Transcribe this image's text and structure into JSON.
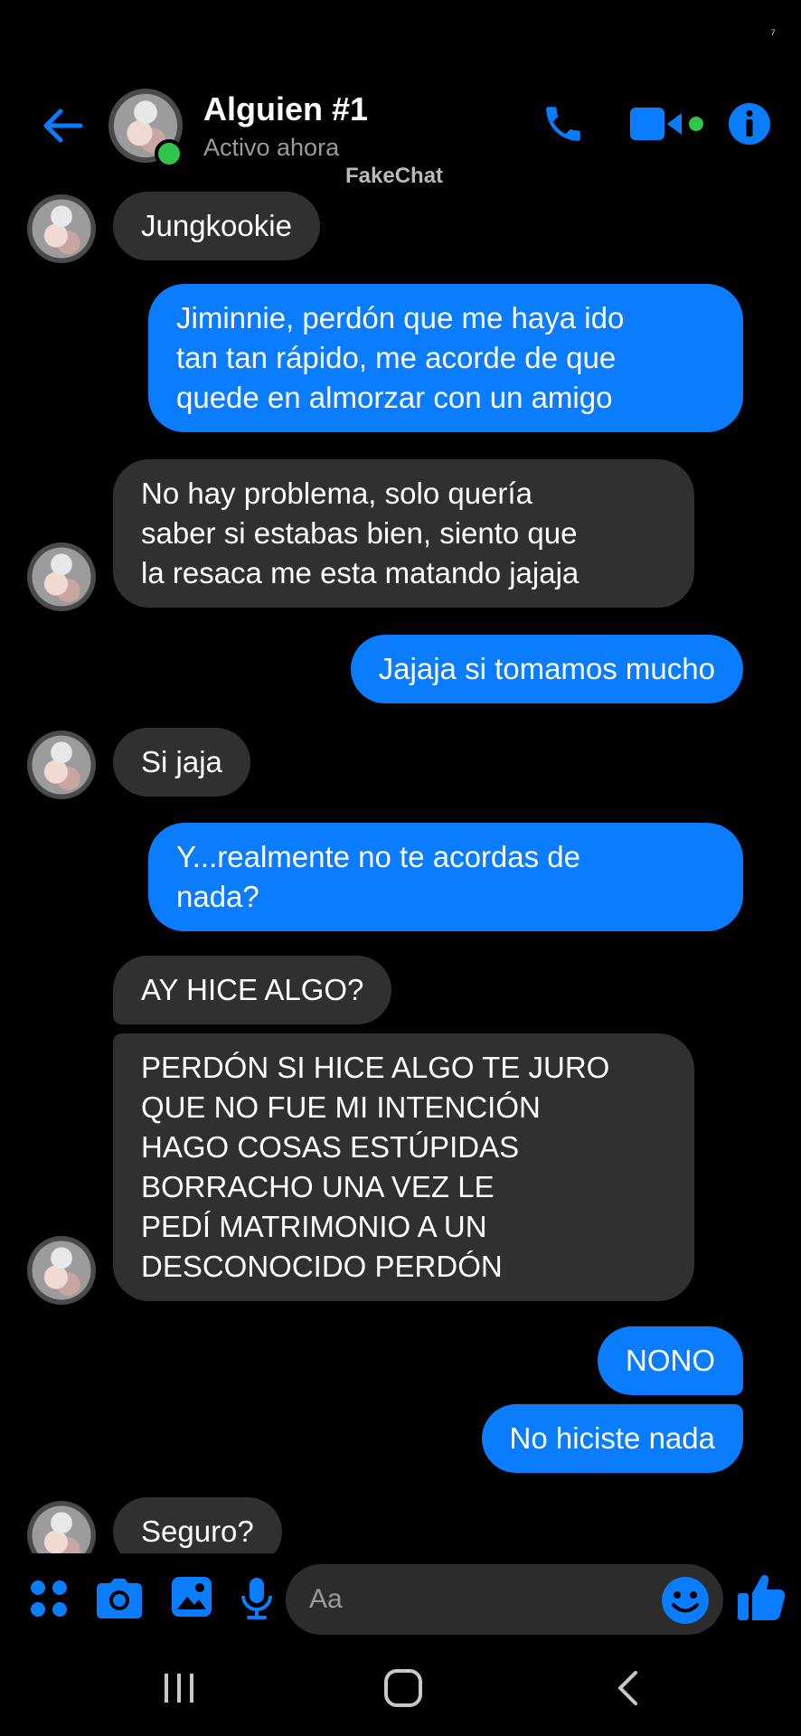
{
  "status_bar": {
    "indicator": "⁷"
  },
  "header": {
    "contact_name": "Alguien #1",
    "contact_status": "Activo ahora",
    "watermark": "FakeChat",
    "icons": [
      "back-arrow-icon",
      "phone-icon",
      "video-camera-icon",
      "info-icon"
    ]
  },
  "colors": {
    "accent": "#0a7cff",
    "incoming_bubble": "#303030",
    "online": "#31c44b",
    "background": "#000000"
  },
  "messages": [
    {
      "from": "contact",
      "text": "Jungkookie"
    },
    {
      "from": "me",
      "text": "Jiminnie, perdón que me haya ido\ntan tan rápido, me acorde de que\nquede en almorzar con un amigo"
    },
    {
      "from": "contact",
      "text": "No hay problema, solo quería\nsaber si estabas bien, siento que\nla resaca me esta matando jajaja"
    },
    {
      "from": "me",
      "text": "Jajaja si tomamos mucho"
    },
    {
      "from": "contact",
      "text": "Si jaja"
    },
    {
      "from": "me",
      "text": "Y...realmente no te acordas de\nnada?"
    },
    {
      "from": "contact",
      "text": "AY HICE ALGO?"
    },
    {
      "from": "contact",
      "text": "PERDÓN SI HICE ALGO TE JURO\nQUE NO FUE MI INTENCIÓN\nHAGO COSAS ESTÚPIDAS\nBORRACHO UNA VEZ LE\nPEDÍ MATRIMONIO A UN\nDESCONOCIDO PERDÓN"
    },
    {
      "from": "me",
      "text": "NONO"
    },
    {
      "from": "me",
      "text": "No hiciste nada"
    },
    {
      "from": "contact",
      "text": "Seguro?"
    }
  ],
  "composer": {
    "placeholder": "Aa",
    "icons": [
      "apps-grid-icon",
      "camera-icon",
      "gallery-icon",
      "microphone-icon",
      "emoji-icon",
      "thumbs-up-icon"
    ]
  },
  "nav_bar": {
    "icons": [
      "recent-apps-icon",
      "home-icon",
      "back-icon"
    ]
  }
}
